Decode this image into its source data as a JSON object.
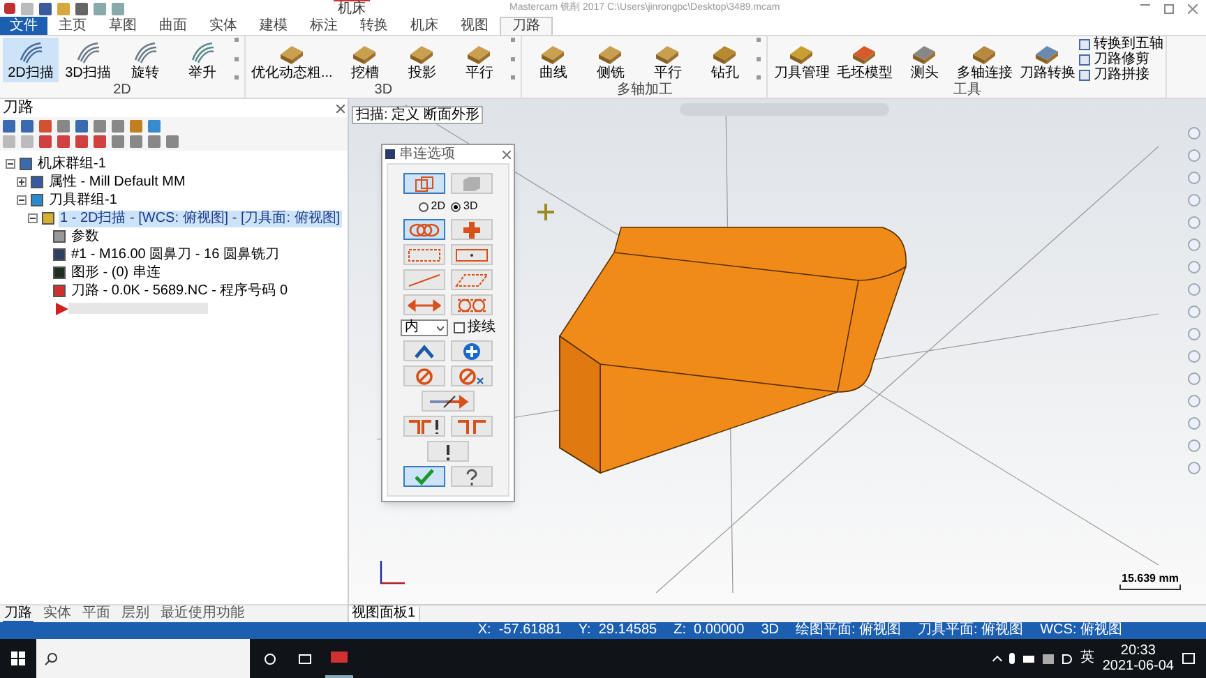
{
  "title_bar": {
    "context_tab": "机床",
    "title": "Mastercam 铣削 2017  C:\\Users\\jinrongpc\\Desktop\\3489.mcam"
  },
  "tabs": [
    {
      "label": "文件",
      "kind": "file",
      "selected": false
    },
    {
      "label": "主页",
      "kind": "tab",
      "selected": false
    },
    {
      "label": "草图",
      "kind": "tab",
      "selected": false
    },
    {
      "label": "曲面",
      "kind": "tab",
      "selected": false
    },
    {
      "label": "实体",
      "kind": "tab",
      "selected": false
    },
    {
      "label": "建模",
      "kind": "tab",
      "selected": false
    },
    {
      "label": "标注",
      "kind": "tab",
      "selected": false
    },
    {
      "label": "转换",
      "kind": "tab",
      "selected": false
    },
    {
      "label": "机床",
      "kind": "tab",
      "selected": false
    },
    {
      "label": "视图",
      "kind": "tab",
      "selected": false
    },
    {
      "label": "刀路",
      "kind": "tab",
      "selected": true
    }
  ],
  "ribbon": [
    {
      "label": "2D",
      "more": true,
      "buttons": [
        {
          "label": "2D扫描",
          "kind": "sweep2d",
          "selected": true
        },
        {
          "label": "3D扫描",
          "kind": "sweep3d",
          "selected": false
        },
        {
          "label": "旋转",
          "kind": "revolve",
          "selected": false
        },
        {
          "label": "举升",
          "kind": "loft",
          "selected": false
        }
      ]
    },
    {
      "label": "3D",
      "more": true,
      "buttons": [
        {
          "label": "优化动态粗...",
          "kind": "rough",
          "selected": false
        },
        {
          "label": "挖槽",
          "kind": "pocket",
          "selected": false
        },
        {
          "label": "投影",
          "kind": "project",
          "selected": false
        },
        {
          "label": "平行",
          "kind": "parallel",
          "selected": false
        }
      ]
    },
    {
      "label": "多轴加工",
      "more": true,
      "buttons": [
        {
          "label": "曲线",
          "kind": "curve",
          "selected": false
        },
        {
          "label": "侧铣",
          "kind": "swarf",
          "selected": false
        },
        {
          "label": "平行",
          "kind": "parallel",
          "selected": false
        },
        {
          "label": "钻孔",
          "kind": "drill",
          "selected": false
        }
      ]
    },
    {
      "label": "工具",
      "more": false,
      "buttons": [
        {
          "label": "刀具管理",
          "kind": "tool",
          "selected": false
        },
        {
          "label": "毛坯模型",
          "kind": "stock",
          "selected": false
        },
        {
          "label": "测头",
          "kind": "probe",
          "selected": false
        },
        {
          "label": "多轴连接",
          "kind": "link",
          "selected": false
        },
        {
          "label": "刀路转换",
          "kind": "transform",
          "selected": false
        }
      ],
      "small_buttons": [
        "转换到五轴",
        "刀路修剪",
        "刀路拼接"
      ]
    }
  ],
  "panel": {
    "title": "刀路",
    "tree": [
      {
        "label": "机床群组-1",
        "kind": "machine",
        "expanded": true,
        "selected": false,
        "children": [
          {
            "label": "属性 - Mill Default MM",
            "kind": "props",
            "expanded": false,
            "selected": false
          },
          {
            "label": "刀具群组-1",
            "kind": "toolgroup",
            "expanded": true,
            "selected": false,
            "children": [
              {
                "label": "1 - 2D扫描 - [WCS: 俯视图] - [刀具面: 俯视图]",
                "kind": "operation",
                "expanded": true,
                "selected": true,
                "children": [
                  {
                    "label": "参数",
                    "kind": "params",
                    "selected": false
                  },
                  {
                    "label": "#1 - M16.00 圆鼻刀 - 16 圆鼻铣刀",
                    "kind": "cutter",
                    "selected": false
                  },
                  {
                    "label": "图形 - (0) 串连",
                    "kind": "geometry",
                    "selected": false
                  },
                  {
                    "label": "刀路 - 0.0K - 5689.NC - 程序号码 0",
                    "kind": "path",
                    "selected": false
                  }
                ]
              }
            ]
          }
        ]
      }
    ],
    "bottom_tabs": [
      {
        "label": "刀路",
        "selected": true
      },
      {
        "label": "实体",
        "selected": false
      },
      {
        "label": "平面",
        "selected": false
      },
      {
        "label": "层别",
        "selected": false
      },
      {
        "label": "最近使用功能",
        "selected": false
      }
    ]
  },
  "viewport": {
    "prompt": "扫描: 定义 断面外形",
    "scale": "15.639 mm",
    "view_tab": "视图面板1"
  },
  "dialog": {
    "title": "串连选项",
    "rows": [
      [
        {
          "kind": "wire",
          "selected": true
        },
        {
          "kind": "solid",
          "selected": false
        }
      ],
      [
        {
          "kind": "radio",
          "label": "2D",
          "selected": false
        },
        {
          "kind": "radio",
          "label": "3D",
          "selected": true
        }
      ],
      [
        {
          "kind": "chain",
          "selected": true
        },
        {
          "kind": "point",
          "selected": false
        }
      ],
      [
        {
          "kind": "window",
          "selected": false
        },
        {
          "kind": "area",
          "selected": false
        }
      ],
      [
        {
          "kind": "single",
          "selected": false
        },
        {
          "kind": "polygon",
          "selected": false
        }
      ],
      [
        {
          "kind": "vector",
          "selected": false
        },
        {
          "kind": "partial",
          "selected": false
        }
      ],
      [
        {
          "kind": "dropdown",
          "label": "内"
        },
        {
          "kind": "checkbox",
          "label": "接续",
          "checked": false
        }
      ],
      [
        {
          "kind": "last",
          "selected": false
        },
        {
          "kind": "add",
          "selected": false
        }
      ],
      [
        {
          "kind": "stop",
          "selected": false
        },
        {
          "kind": "unselect",
          "selected": false
        }
      ],
      [
        {
          "kind": "reverse",
          "selected": false
        }
      ],
      [
        {
          "kind": "end",
          "selected": false
        },
        {
          "kind": "start",
          "selected": false
        }
      ],
      [
        {
          "kind": "warn",
          "selected": false
        }
      ],
      [
        {
          "kind": "ok",
          "selected": true
        },
        {
          "kind": "help",
          "selected": false
        }
      ]
    ]
  },
  "status_bar": [
    "X:  -57.61881",
    "Y:  29.14585",
    "Z:  0.00000",
    "3D",
    "绘图平面: 俯视图",
    "刀具平面: 俯视图",
    "WCS: 俯视图"
  ],
  "taskbar": {
    "ime": "英",
    "time": "20:33",
    "date": "2021-06-04"
  }
}
